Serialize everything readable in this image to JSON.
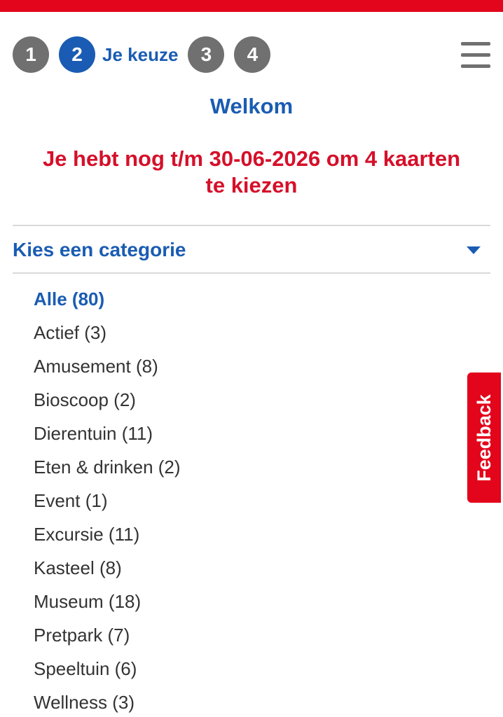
{
  "colors": {
    "brand_red": "#e3051b",
    "primary_blue": "#1a5cb3",
    "step_gray": "#707070"
  },
  "steps": [
    {
      "number": "1",
      "state": "inactive"
    },
    {
      "number": "2",
      "state": "active",
      "label": "Je keuze"
    },
    {
      "number": "3",
      "state": "inactive"
    },
    {
      "number": "4",
      "state": "inactive"
    }
  ],
  "header": {
    "menu_icon": "hamburger-icon"
  },
  "main": {
    "title": "Welkom",
    "notice_line1": "Je hebt nog t/m 30-06-2026 om 4 kaarten",
    "notice_line2": "te kiezen"
  },
  "category_select": {
    "label": "Kies een categorie",
    "icon": "caret-down-icon"
  },
  "categories": [
    {
      "label": "Alle (80)",
      "selected": true
    },
    {
      "label": "Actief (3)"
    },
    {
      "label": "Amusement (8)"
    },
    {
      "label": "Bioscoop (2)"
    },
    {
      "label": "Dierentuin (11)"
    },
    {
      "label": "Eten & drinken (2)"
    },
    {
      "label": "Event (1)"
    },
    {
      "label": "Excursie (11)"
    },
    {
      "label": "Kasteel (8)"
    },
    {
      "label": "Museum (18)"
    },
    {
      "label": "Pretpark (7)"
    },
    {
      "label": "Speeltuin (6)"
    },
    {
      "label": "Wellness (3)"
    }
  ],
  "feedback": {
    "label": "Feedback"
  }
}
